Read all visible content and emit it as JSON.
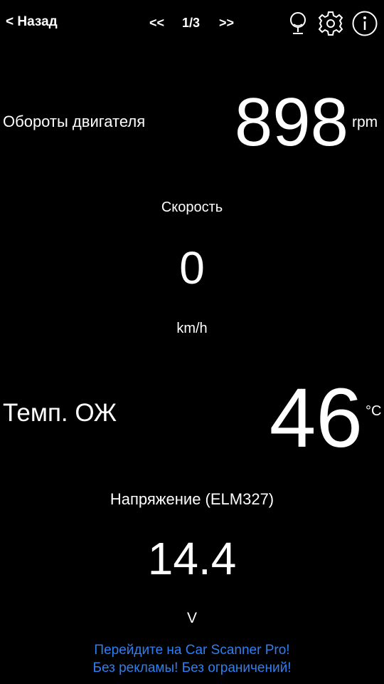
{
  "topbar": {
    "back_label": "< Назад",
    "prev_label": "<<",
    "page_indicator": "1/3",
    "next_label": ">>",
    "icons": [
      "microphone-icon",
      "gear-icon",
      "info-icon"
    ]
  },
  "gauges": {
    "rpm": {
      "label": "Обороты двигателя",
      "value": "898",
      "unit": "rpm"
    },
    "speed": {
      "label": "Скорость",
      "value": "0",
      "unit": "km/h"
    },
    "coolant_temp": {
      "label": "Темп. ОЖ",
      "value": "46",
      "unit": "°C"
    },
    "voltage": {
      "label": "Напряжение (ELM327)",
      "value": "14.4",
      "unit": "V"
    }
  },
  "promo": {
    "line1": "Перейдите на Car Scanner Pro!",
    "line2": "Без рекламы! Без ограничений!",
    "color": "#2f7ff0"
  },
  "colors": {
    "background": "#000000",
    "text": "#ffffff"
  }
}
